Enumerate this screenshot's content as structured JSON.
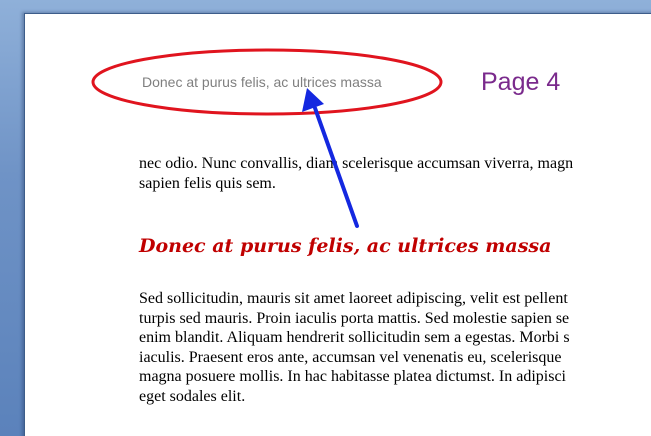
{
  "header": {
    "text": "Donec at purus felis, ac ultrices massa"
  },
  "annotation": {
    "page_label": "Page 4",
    "ellipse_color": "#e0141e",
    "arrow_color": "#1428e0"
  },
  "body": {
    "paragraph_1": [
      "nec odio. Nunc convallis, diam scelerisque accumsan viverra, magn",
      "sapien felis quis sem."
    ],
    "heading": "Donec at purus felis, ac ultrices massa",
    "paragraph_2": [
      "Sed sollicitudin, mauris sit amet laoreet adipiscing, velit est pellent",
      "turpis sed mauris. Proin iaculis porta mattis. Sed molestie sapien se",
      "enim blandit. Aliquam hendrerit sollicitudin sem a egestas. Morbi s",
      "iaculis. Praesent eros ante, accumsan vel venenatis eu, scelerisque",
      "magna posuere mollis. In hac habitasse platea dictumst. In adipisci",
      "eget sodales elit."
    ]
  }
}
